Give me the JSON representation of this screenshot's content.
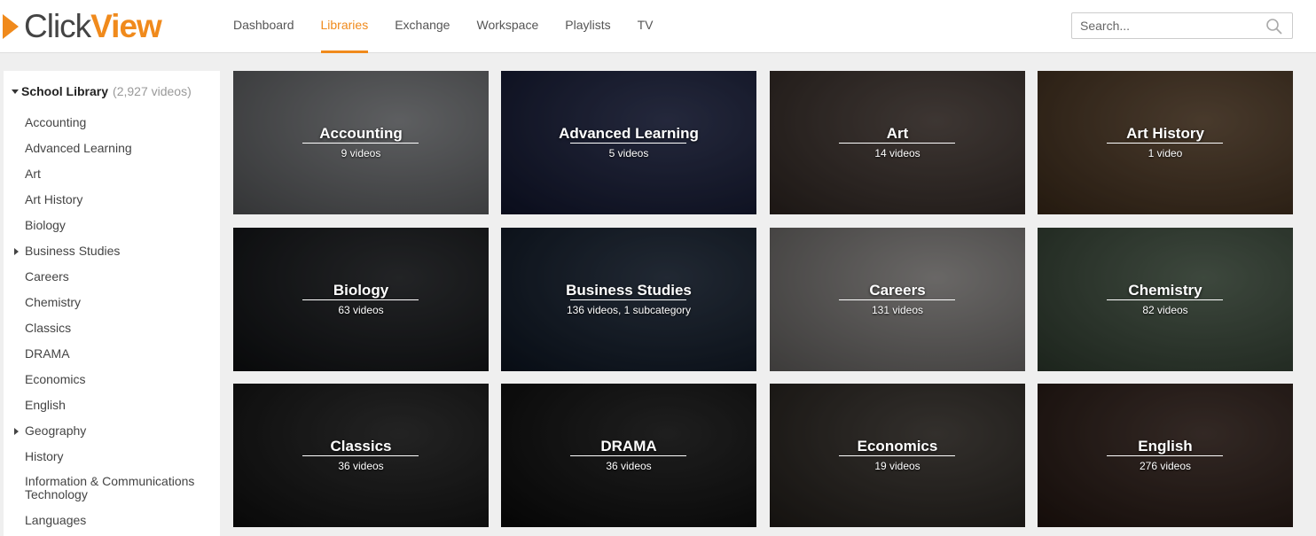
{
  "logo": {
    "part1": "Click",
    "part2": "View"
  },
  "nav": [
    {
      "label": "Dashboard",
      "active": false
    },
    {
      "label": "Libraries",
      "active": true
    },
    {
      "label": "Exchange",
      "active": false
    },
    {
      "label": "Workspace",
      "active": false
    },
    {
      "label": "Playlists",
      "active": false
    },
    {
      "label": "TV",
      "active": false
    }
  ],
  "search": {
    "placeholder": "Search...",
    "value": ""
  },
  "sidebar": {
    "library_name": "School Library",
    "library_count": "(2,927 videos)",
    "items": [
      {
        "label": "Accounting",
        "expandable": false
      },
      {
        "label": "Advanced Learning",
        "expandable": false
      },
      {
        "label": "Art",
        "expandable": false
      },
      {
        "label": "Art History",
        "expandable": false
      },
      {
        "label": "Biology",
        "expandable": false
      },
      {
        "label": "Business Studies",
        "expandable": true
      },
      {
        "label": "Careers",
        "expandable": false
      },
      {
        "label": "Chemistry",
        "expandable": false
      },
      {
        "label": "Classics",
        "expandable": false
      },
      {
        "label": "DRAMA",
        "expandable": false
      },
      {
        "label": "Economics",
        "expandable": false
      },
      {
        "label": "English",
        "expandable": false
      },
      {
        "label": "Geography",
        "expandable": true
      },
      {
        "label": "History",
        "expandable": false
      },
      {
        "label": "Information & Communications Technology",
        "expandable": false
      },
      {
        "label": "Languages",
        "expandable": false
      }
    ]
  },
  "tiles": [
    {
      "title": "Accounting",
      "subtitle": "9 videos",
      "bg": "#6b6d70"
    },
    {
      "title": "Advanced Learning",
      "subtitle": "5 videos",
      "bg": "#141a38"
    },
    {
      "title": "Art",
      "subtitle": "14 videos",
      "bg": "#3a2f2a"
    },
    {
      "title": "Art History",
      "subtitle": "1 video",
      "bg": "#4b3520"
    },
    {
      "title": "Biology",
      "subtitle": "63 videos",
      "bg": "#111316"
    },
    {
      "title": "Business Studies",
      "subtitle": "136 videos, 1 subcategory",
      "bg": "#0f1a2a"
    },
    {
      "title": "Careers",
      "subtitle": "131 videos",
      "bg": "#7d7a78"
    },
    {
      "title": "Chemistry",
      "subtitle": "82 videos",
      "bg": "#3a4a3a"
    },
    {
      "title": "Classics",
      "subtitle": "36 videos",
      "bg": "#121212"
    },
    {
      "title": "DRAMA",
      "subtitle": "36 videos",
      "bg": "#0b0b0b"
    },
    {
      "title": "Economics",
      "subtitle": "19 videos",
      "bg": "#2a2520"
    },
    {
      "title": "English",
      "subtitle": "276 videos",
      "bg": "#2a1a14"
    }
  ]
}
